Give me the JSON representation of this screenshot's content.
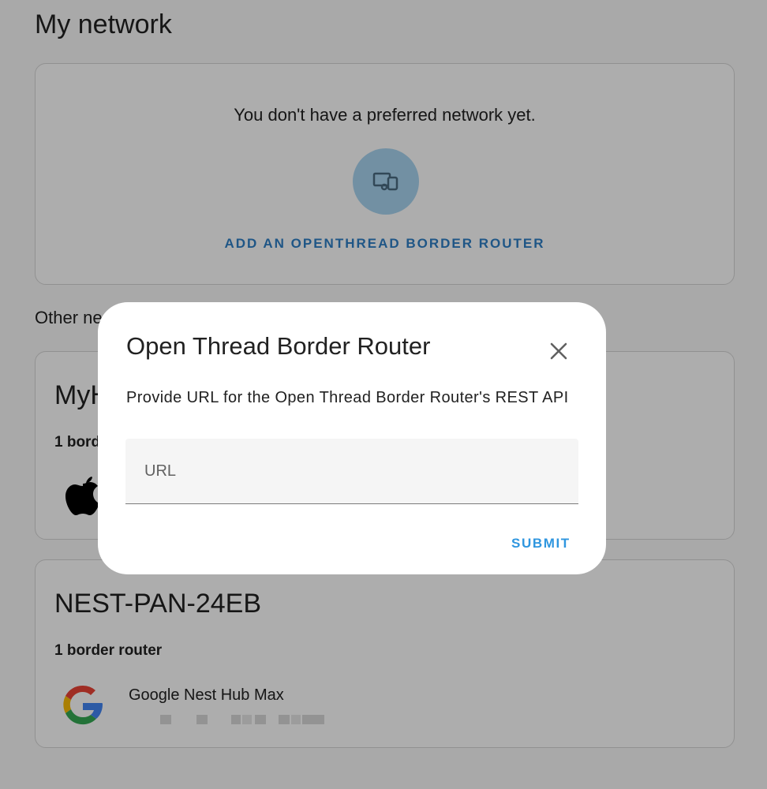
{
  "page": {
    "title": "My network",
    "other_networks_label": "Other ne"
  },
  "preferred": {
    "empty_message": "You don't have a preferred network yet.",
    "icon": "devices-icon",
    "add_label": "ADD AN OPENTHREAD BORDER ROUTER"
  },
  "networks": [
    {
      "name": "MyH",
      "border_router_count": "1 bord",
      "logo": "apple-logo"
    },
    {
      "name": "NEST-PAN-24EB",
      "border_router_count": "1 border router",
      "logo": "google-logo",
      "router_name": "Google Nest Hub Max"
    }
  ],
  "dialog": {
    "title": "Open Thread Border Router",
    "description": "Provide URL for the Open Thread Border Router's REST API",
    "url_placeholder": "URL",
    "url_value": "",
    "submit_label": "SUBMIT",
    "close_icon": "close-icon"
  },
  "colors": {
    "accent": "#2f7fc6",
    "submit": "#2f96df",
    "icon_circle": "#a9d4f0"
  }
}
